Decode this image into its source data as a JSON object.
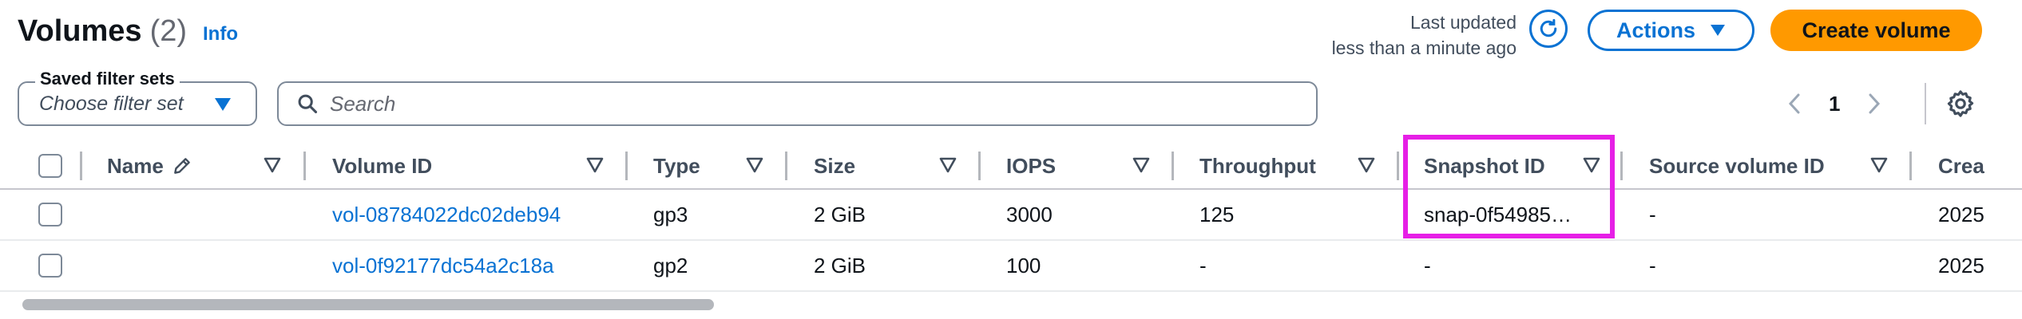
{
  "header": {
    "title": "Volumes",
    "count": "(2)",
    "info_link": "Info",
    "last_updated_line1": "Last updated",
    "last_updated_line2": "less than a minute ago",
    "actions_label": "Actions",
    "create_label": "Create volume"
  },
  "filters": {
    "saved_filter_sets_label": "Saved filter sets",
    "saved_filter_sets_placeholder": "Choose filter set",
    "search_placeholder": "Search"
  },
  "pagination": {
    "current_page": "1"
  },
  "table": {
    "columns": [
      {
        "label": "Name"
      },
      {
        "label": "Volume ID"
      },
      {
        "label": "Type"
      },
      {
        "label": "Size"
      },
      {
        "label": "IOPS"
      },
      {
        "label": "Throughput"
      },
      {
        "label": "Snapshot ID"
      },
      {
        "label": "Source volume ID"
      },
      {
        "label": "Crea"
      }
    ],
    "rows": [
      {
        "name": "",
        "volume_id": "vol-08784022dc02deb94",
        "type": "gp3",
        "size": "2 GiB",
        "iops": "3000",
        "throughput": "125",
        "snapshot_id": "snap-0f54985…",
        "source_volume_id": "-",
        "created": "2025"
      },
      {
        "name": "",
        "volume_id": "vol-0f92177dc54a2c18a",
        "type": "gp2",
        "size": "2 GiB",
        "iops": "100",
        "throughput": "-",
        "snapshot_id": "-",
        "source_volume_id": "-",
        "created": "2025"
      }
    ]
  },
  "colors": {
    "link": "#0972d3",
    "primary_button": "#ff9900",
    "highlight": "#e61fe6"
  },
  "icons": [
    "refresh-icon",
    "caret-down-icon",
    "search-icon",
    "chevron-left-icon",
    "chevron-right-icon",
    "gear-icon",
    "pencil-icon",
    "sort-icon"
  ]
}
